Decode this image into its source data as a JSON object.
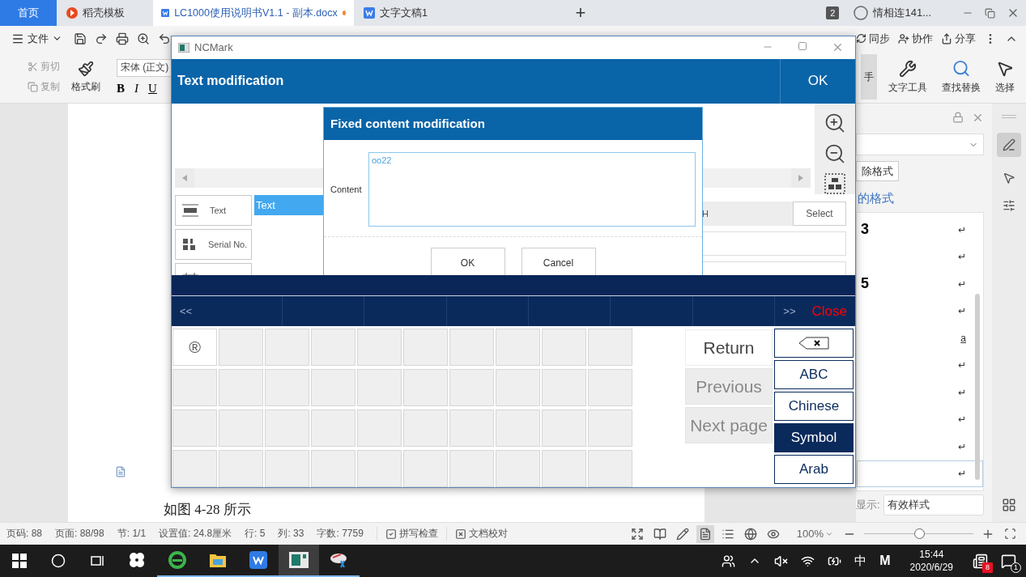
{
  "browser_tabs": [
    {
      "kind": "home",
      "label": "首页",
      "selected": false,
      "unsaved": false
    },
    {
      "kind": "docer",
      "label": "稻壳模板",
      "selected": false,
      "unsaved": false
    },
    {
      "kind": "doc",
      "label": "LC1000使用说明书V1.1 - 副本.docx",
      "selected": true,
      "unsaved": true
    },
    {
      "kind": "doc",
      "label": "文字文稿1",
      "selected": false,
      "unsaved": false
    }
  ],
  "new_tab": "+",
  "window_count": "2",
  "user": "情相连141...",
  "ribbon": {
    "menu": "文件",
    "right_actions": [
      {
        "kind": "sync",
        "label": "同步"
      },
      {
        "kind": "share-people",
        "label": "协作"
      },
      {
        "kind": "share",
        "label": "分享"
      }
    ],
    "clipboard": [
      "剪切",
      "复制"
    ],
    "format_painter": "格式刷",
    "font": "宋体 (正文)",
    "format_buttons": [
      "B",
      "I",
      "U"
    ],
    "tools": [
      {
        "kind": "assistant",
        "label": "手"
      },
      {
        "kind": "text-tools",
        "label": "文字工具"
      },
      {
        "kind": "find",
        "label": "查找替换"
      },
      {
        "kind": "select",
        "label": "选择"
      }
    ]
  },
  "document": {
    "caption": "如图 4-28 所示"
  },
  "style_pane": {
    "clear_format": "除格式",
    "heading": "的格式",
    "rows": [
      {
        "fragment": "3",
        "mark": "↵",
        "selected": false
      },
      {
        "mark": "↵",
        "selected": false
      },
      {
        "fragment": "5",
        "mark": "↵",
        "selected": false
      },
      {
        "mark": "↵",
        "selected": false
      },
      {
        "mark": "a",
        "selected": false
      },
      {
        "mark": "↵",
        "selected": false
      },
      {
        "mark": "↵",
        "selected": false
      },
      {
        "mark": "↵",
        "selected": false
      },
      {
        "mark": "↵",
        "selected": false
      },
      {
        "mark": "↵",
        "selected": true
      }
    ],
    "show_label": "显示:",
    "show_value": "有效样式"
  },
  "ncmark": {
    "title": "NCMark",
    "header": "Text modification",
    "ok": "OK",
    "components": [
      {
        "kind": "text",
        "label": "Text"
      },
      {
        "kind": "serial",
        "label": "Serial No."
      },
      {
        "kind": "date"
      }
    ],
    "layers": [
      {
        "label": "Text",
        "selected": true
      }
    ],
    "property_label": "H",
    "select_button": "Select",
    "dialog": {
      "title": "Fixed content modification",
      "content_label": "Content",
      "content_value": "oo22",
      "ok": "OK",
      "cancel": "Cancel"
    },
    "keyboard": {
      "prev": "<<",
      "next": ">>",
      "close": "Close",
      "keys": [
        "®"
      ],
      "actions": [
        {
          "label": "Return",
          "disabled": false
        },
        {
          "label": "Previous",
          "disabled": true
        },
        {
          "label": "Next page",
          "disabled": true
        }
      ],
      "modes": [
        {
          "kind": "backspace",
          "selected": false
        },
        {
          "kind": "key",
          "label": "ABC",
          "selected": false
        },
        {
          "kind": "key",
          "label": "Chinese",
          "selected": false
        },
        {
          "kind": "key",
          "label": "Symbol",
          "selected": true
        },
        {
          "kind": "key",
          "label": "Arab",
          "selected": false
        }
      ]
    }
  },
  "status_bar": {
    "items": [
      "页码: 88",
      "页面: 88/98",
      "节: 1/1",
      "设置值: 24.8厘米",
      "行: 5",
      "列: 33",
      "字数: 7759"
    ],
    "checks": [
      {
        "kind": "spell",
        "label": "拼写检查"
      },
      {
        "kind": "proof",
        "label": "文档校对"
      }
    ],
    "views": [
      {
        "kind": "fullscreen",
        "selected": false
      },
      {
        "kind": "read",
        "selected": false
      },
      {
        "kind": "write",
        "selected": false
      },
      {
        "kind": "page",
        "selected": true
      },
      {
        "kind": "outline",
        "selected": false
      },
      {
        "kind": "web",
        "selected": false
      },
      {
        "kind": "eye",
        "selected": false
      }
    ],
    "zoom": "100%",
    "zoom_slider": {
      "level": 0.5
    }
  },
  "taskbar": {
    "apps": [
      {
        "kind": "fan",
        "running": false,
        "selected": false
      },
      {
        "kind": "ie",
        "running": true,
        "selected": false
      },
      {
        "kind": "explorer",
        "running": true,
        "selected": false
      },
      {
        "kind": "wps",
        "running": true,
        "selected": false
      },
      {
        "kind": "ncmark",
        "running": true,
        "selected": true
      },
      {
        "kind": "paint",
        "running": true,
        "selected": false
      }
    ],
    "ime": "中",
    "ime_mode": "M",
    "time": "15:44",
    "date": "2020/6/29",
    "notifications": "8",
    "actions": "1"
  }
}
